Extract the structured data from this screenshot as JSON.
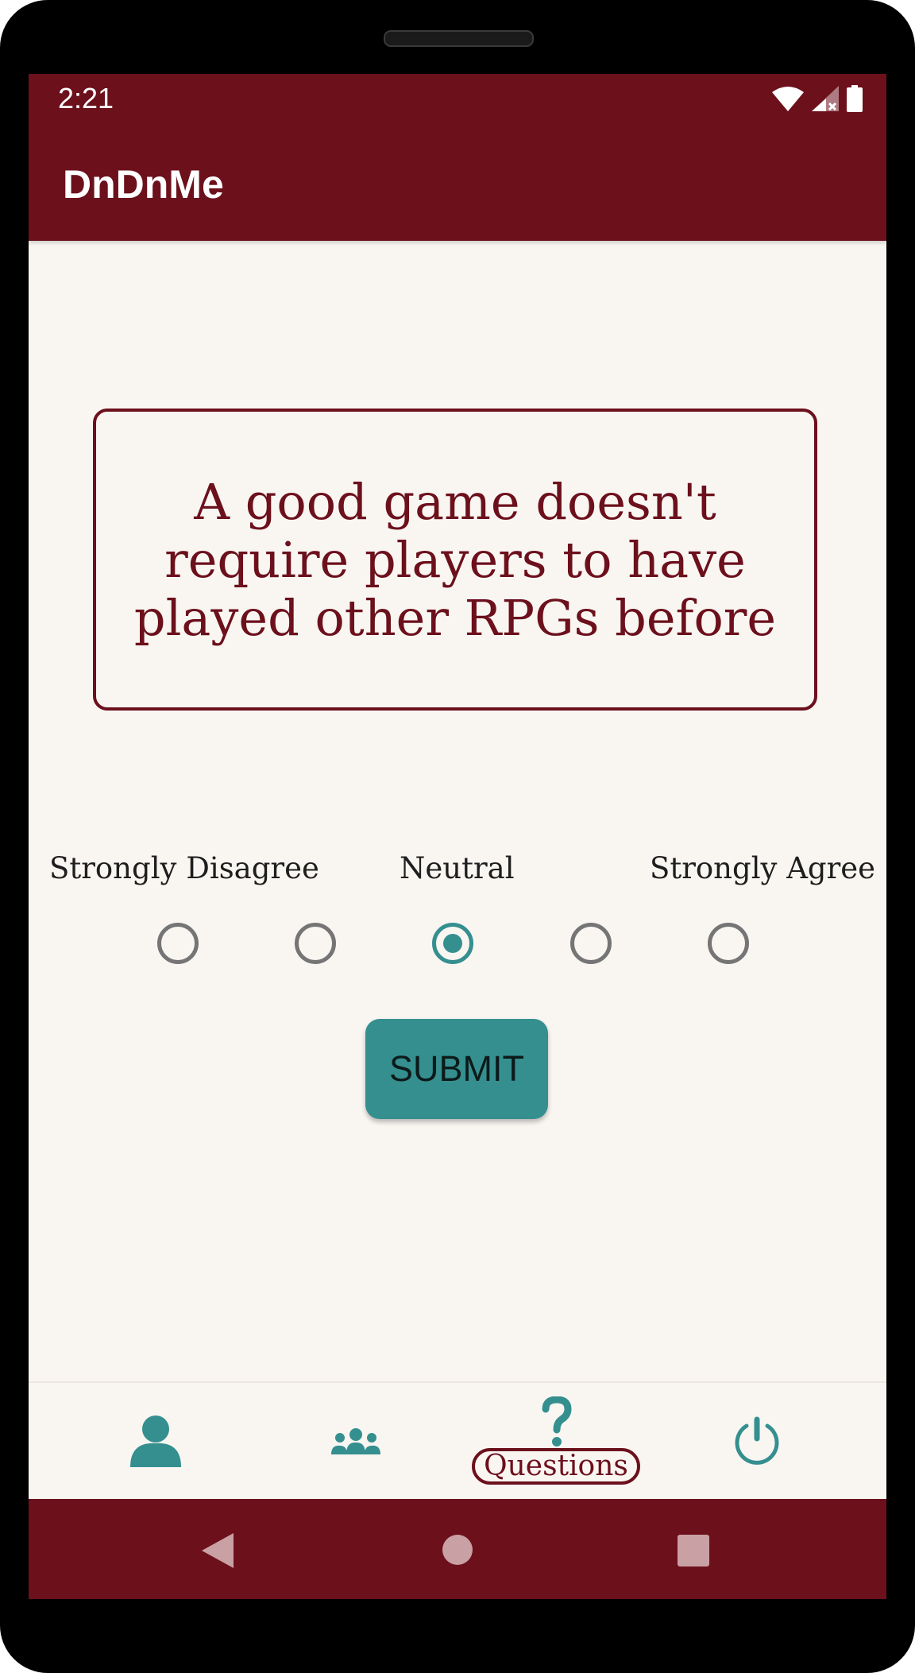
{
  "status_bar": {
    "time": "2:21",
    "icons": [
      "wifi-icon",
      "signal-icon",
      "battery-icon"
    ]
  },
  "app_bar": {
    "title": "DnDnMe"
  },
  "question": {
    "text": "A good game doesn't require players to have played other RPGs before"
  },
  "scale": {
    "labels": {
      "left": "Strongly Disagree",
      "center": "Neutral",
      "right": "Strongly Agree"
    },
    "options_count": 5,
    "selected_index": 2
  },
  "submit": {
    "label": "SUBMIT"
  },
  "bottom_nav": {
    "items": [
      {
        "icon": "person-icon",
        "label": ""
      },
      {
        "icon": "group-icon",
        "label": ""
      },
      {
        "icon": "question-icon",
        "label": "Questions",
        "active": true
      },
      {
        "icon": "power-icon",
        "label": ""
      }
    ]
  },
  "system_nav": {
    "icons": [
      "back-icon",
      "home-icon",
      "recents-icon"
    ]
  },
  "colors": {
    "primary": "#6c101c",
    "accent": "#358f8f",
    "background": "#f9f6f2"
  }
}
